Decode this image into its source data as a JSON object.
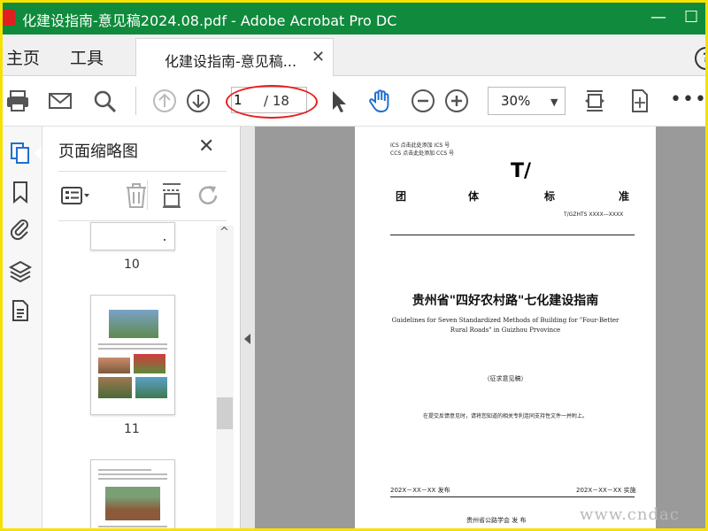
{
  "window": {
    "title": "化建设指南-意见稿2024.08.pdf - Adobe Acrobat Pro DC",
    "minimize": "—",
    "maximize": "☐"
  },
  "tabs": {
    "home": "主页",
    "tools": "工具",
    "doc": "化建设指南-意见稿...",
    "close": "✕",
    "help": "?"
  },
  "toolbar": {
    "page_current": "1",
    "page_total": "/ 18",
    "zoom": "30%",
    "zoom_caret": "▼",
    "more": "•••"
  },
  "thumbnails": {
    "title": "页面缩略图",
    "close": "✕",
    "scroll_up": "^",
    "pages": [
      {
        "label": "10"
      },
      {
        "label": "11"
      }
    ]
  },
  "pdf": {
    "ics": "ICS  点击此处添加 ICS 号",
    "ccs": "CCS  点击此处添加 CCS 号",
    "logo": "T/",
    "type_chars": [
      "团",
      "体",
      "标",
      "准"
    ],
    "std_no": "T/GZHTS  XXXX—XXXX",
    "title": "贵州省\"四好农村路\"七化建设指南",
    "subtitle": "Guidelines for Seven Standardized Methods of Building for \"Four-Better Rural Roads\" in Guizhou Prvovince",
    "draft": "（征求意见稿）",
    "note": "在提交反馈意见时，请将您知道的相关专利连同支持性文件一并附上。",
    "release_date": "202X－XX－XX 发布",
    "impl_date": "202X－XX－XX 实施",
    "issuer": "贵州省公路学会     发 布"
  },
  "watermark": "www.cndac"
}
